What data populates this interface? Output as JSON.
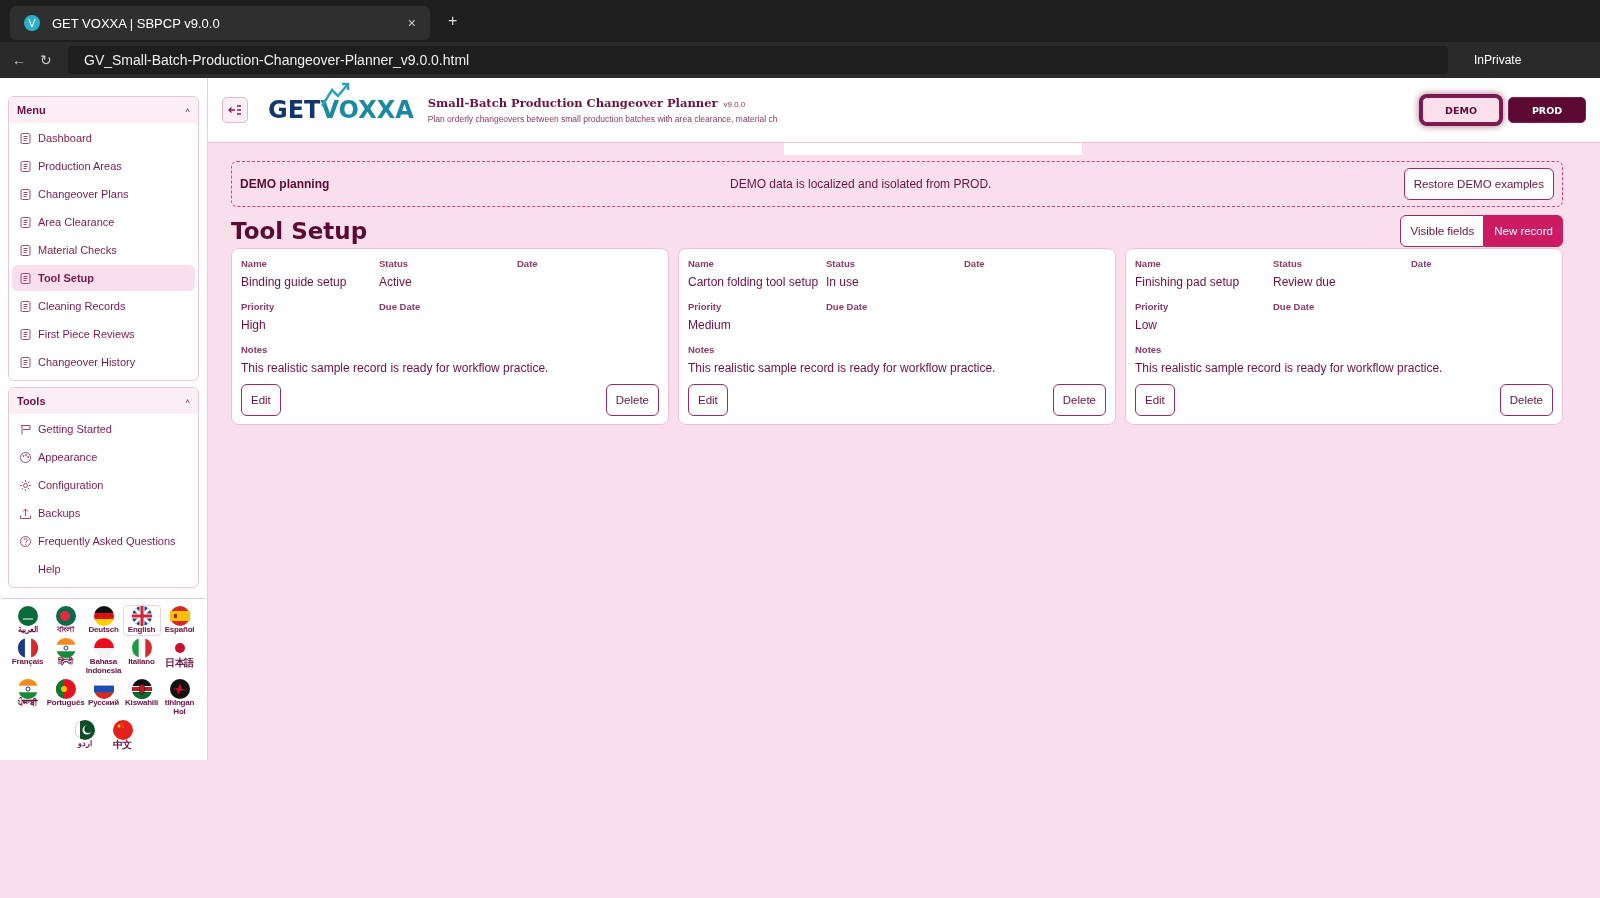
{
  "browser": {
    "tab_icon": "V",
    "tab_title": "GET VOXXA | SBPCP v9.0.0",
    "tab_close": "×",
    "new_tab": "+",
    "back": "←",
    "reload": "↻",
    "address": "GV_Small-Batch-Production-Changeover-Planner_v9.0.0.html",
    "mode": "InPrivate"
  },
  "sidebar": {
    "sections": [
      {
        "title": "Menu",
        "toggle": "˄",
        "expanded": true,
        "items": [
          {
            "label": "Dashboard",
            "kind": "doc",
            "selected": false
          },
          {
            "label": "Production Areas",
            "kind": "doc",
            "selected": false
          },
          {
            "label": "Changeover Plans",
            "kind": "doc",
            "selected": false
          },
          {
            "label": "Area Clearance",
            "kind": "doc",
            "selected": false
          },
          {
            "label": "Material Checks",
            "kind": "doc",
            "selected": false
          },
          {
            "label": "Tool Setup",
            "kind": "doc",
            "selected": true
          },
          {
            "label": "Cleaning Records",
            "kind": "doc",
            "selected": false
          },
          {
            "label": "First Piece Reviews",
            "kind": "doc",
            "selected": false
          },
          {
            "label": "Changeover History",
            "kind": "doc",
            "selected": false
          }
        ]
      },
      {
        "title": "Tools",
        "toggle": "˄",
        "expanded": true,
        "items": [
          {
            "label": "Getting Started",
            "kind": "sign",
            "selected": false
          },
          {
            "label": "Appearance",
            "kind": "palette",
            "selected": false
          },
          {
            "label": "Configuration",
            "kind": "sun",
            "selected": false
          },
          {
            "label": "Backups",
            "kind": "upload",
            "selected": false
          },
          {
            "label": "Frequently Asked Questions",
            "kind": "help",
            "selected": false
          },
          {
            "label": "Help",
            "kind": "plain",
            "selected": false
          }
        ]
      }
    ],
    "languages": [
      {
        "label": "العربية",
        "selected": false
      },
      {
        "label": "বাংলা",
        "selected": false
      },
      {
        "label": "Deutsch",
        "selected": false
      },
      {
        "label": "English",
        "selected": true
      },
      {
        "label": "Español",
        "selected": false
      },
      {
        "label": "Français",
        "selected": false
      },
      {
        "label": "हिन्दी",
        "selected": false
      },
      {
        "label": "Bahasa Indonesia",
        "selected": false
      },
      {
        "label": "Italiano",
        "selected": false
      },
      {
        "label": "日本語",
        "selected": false
      },
      {
        "label": "ਪੰਜਾਬੀ",
        "selected": false
      },
      {
        "label": "Português",
        "selected": false
      },
      {
        "label": "Русский",
        "selected": false
      },
      {
        "label": "Kiswahili",
        "selected": false
      },
      {
        "label": "tlhIngan Hol",
        "selected": false
      },
      {
        "label": "اردو",
        "selected": false
      },
      {
        "label": "中文",
        "selected": false
      }
    ]
  },
  "header": {
    "logo_left": "GET",
    "logo_right": "VOXXA",
    "title": "Small-Batch Production Changeover Planner",
    "version": "v9.0.0",
    "subtitle": "Plan orderly changeovers between small production batches with area clearance, material ch",
    "modes": [
      {
        "label": "DEMO",
        "selected": true
      },
      {
        "label": "PROD",
        "selected": false
      }
    ]
  },
  "banner": {
    "title": "DEMO planning",
    "message": "DEMO data is localized and isolated from PROD.",
    "button": "Restore DEMO examples"
  },
  "page": {
    "title": "Tool Setup",
    "buttons": [
      {
        "label": "Visible fields",
        "kind": "outline"
      },
      {
        "label": "New record",
        "kind": "primary"
      }
    ]
  },
  "records": [
    {
      "fields": [
        {
          "label": "Name",
          "value": "Binding guide setup"
        },
        {
          "label": "Status",
          "value": "Active"
        },
        {
          "label": "Date"
        },
        {
          "label": "Priority",
          "value": "High"
        },
        {
          "label": "Due Date"
        }
      ],
      "notes_label": "Notes",
      "notes": "This realistic sample record is ready for workflow practice.",
      "edit": "Edit",
      "delete": "Delete"
    },
    {
      "fields": [
        {
          "label": "Name",
          "value": "Carton folding tool setup"
        },
        {
          "label": "Status",
          "value": "In use"
        },
        {
          "label": "Date"
        },
        {
          "label": "Priority",
          "value": "Medium"
        },
        {
          "label": "Due Date"
        }
      ],
      "notes_label": "Notes",
      "notes": "This realistic sample record is ready for workflow practice.",
      "edit": "Edit",
      "delete": "Delete"
    },
    {
      "fields": [
        {
          "label": "Name",
          "value": "Finishing pad setup"
        },
        {
          "label": "Status",
          "value": "Review due"
        },
        {
          "label": "Date"
        },
        {
          "label": "Priority",
          "value": "Low"
        },
        {
          "label": "Due Date"
        }
      ],
      "notes_label": "Notes",
      "notes": "This realistic sample record is ready for workflow practice.",
      "edit": "Edit",
      "delete": "Delete"
    }
  ]
}
